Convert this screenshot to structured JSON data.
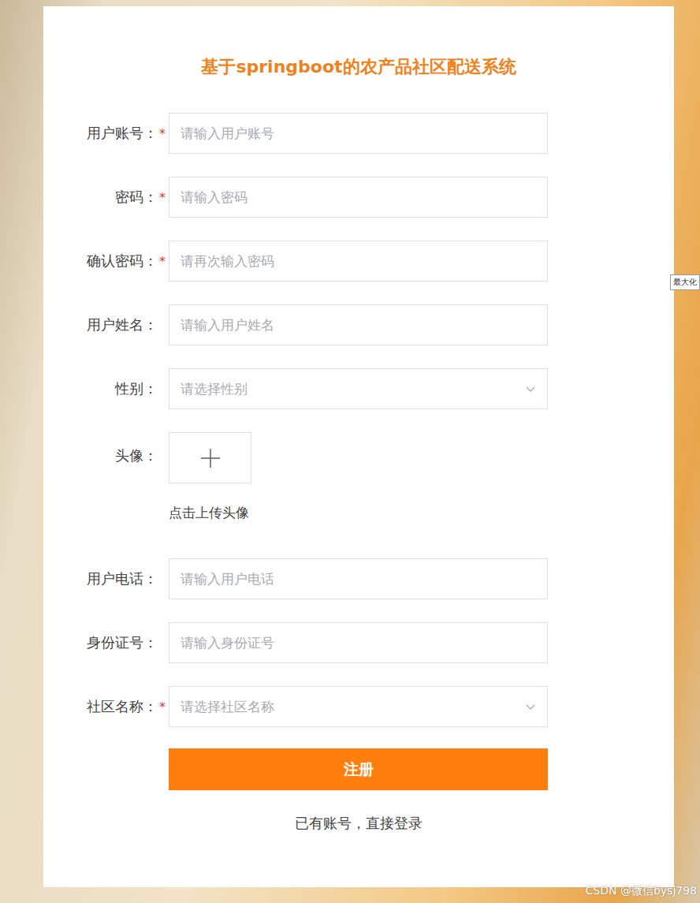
{
  "title": "基于springboot的农产品社区配送系统",
  "fields": [
    {
      "kind": "input",
      "label": "用户账号：",
      "required": true,
      "placeholder": "请输入用户账号"
    },
    {
      "kind": "input",
      "label": "密码：",
      "required": true,
      "placeholder": "请输入密码"
    },
    {
      "kind": "input",
      "label": "确认密码：",
      "required": true,
      "placeholder": "请再次输入密码"
    },
    {
      "kind": "input",
      "label": "用户姓名：",
      "required": false,
      "placeholder": "请输入用户姓名"
    },
    {
      "kind": "select",
      "label": "性别：",
      "required": false,
      "placeholder": "请选择性别"
    },
    {
      "kind": "upload",
      "label": "头像：",
      "required": false,
      "hint": "点击上传头像"
    },
    {
      "kind": "input",
      "label": "用户电话：",
      "required": false,
      "placeholder": "请输入用户电话"
    },
    {
      "kind": "input",
      "label": "身份证号：",
      "required": false,
      "placeholder": "请输入身份证号"
    },
    {
      "kind": "select",
      "label": "社区名称：",
      "required": true,
      "placeholder": "请选择社区名称"
    }
  ],
  "submit": "注册",
  "login_link": "已有账号，直接登录",
  "tooltip": "最大化",
  "watermark": "CSDN @微信bysj798"
}
